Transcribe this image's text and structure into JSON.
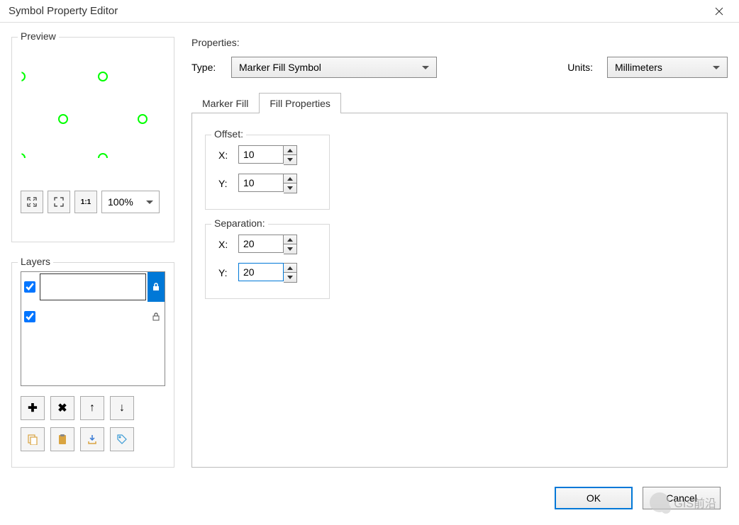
{
  "title": "Symbol Property Editor",
  "preview": {
    "label": "Preview",
    "zoom": "100%"
  },
  "layers": {
    "label": "Layers",
    "items": [
      {
        "checked": true,
        "locked": true,
        "selected": true
      },
      {
        "checked": true,
        "locked": true,
        "selected": false
      }
    ]
  },
  "properties": {
    "label": "Properties:",
    "type_label": "Type:",
    "type_value": "Marker Fill Symbol",
    "units_label": "Units:",
    "units_value": "Millimeters",
    "tabs": {
      "marker_fill": "Marker Fill",
      "fill_properties": "Fill Properties"
    },
    "offset": {
      "label": "Offset:",
      "x_label": "X:",
      "x_value": "10",
      "y_label": "Y:",
      "y_value": "10"
    },
    "separation": {
      "label": "Separation:",
      "x_label": "X:",
      "x_value": "20",
      "y_label": "Y:",
      "y_value": "20"
    }
  },
  "buttons": {
    "ok": "OK",
    "cancel": "Cancel"
  },
  "watermark": "GIS前沿"
}
